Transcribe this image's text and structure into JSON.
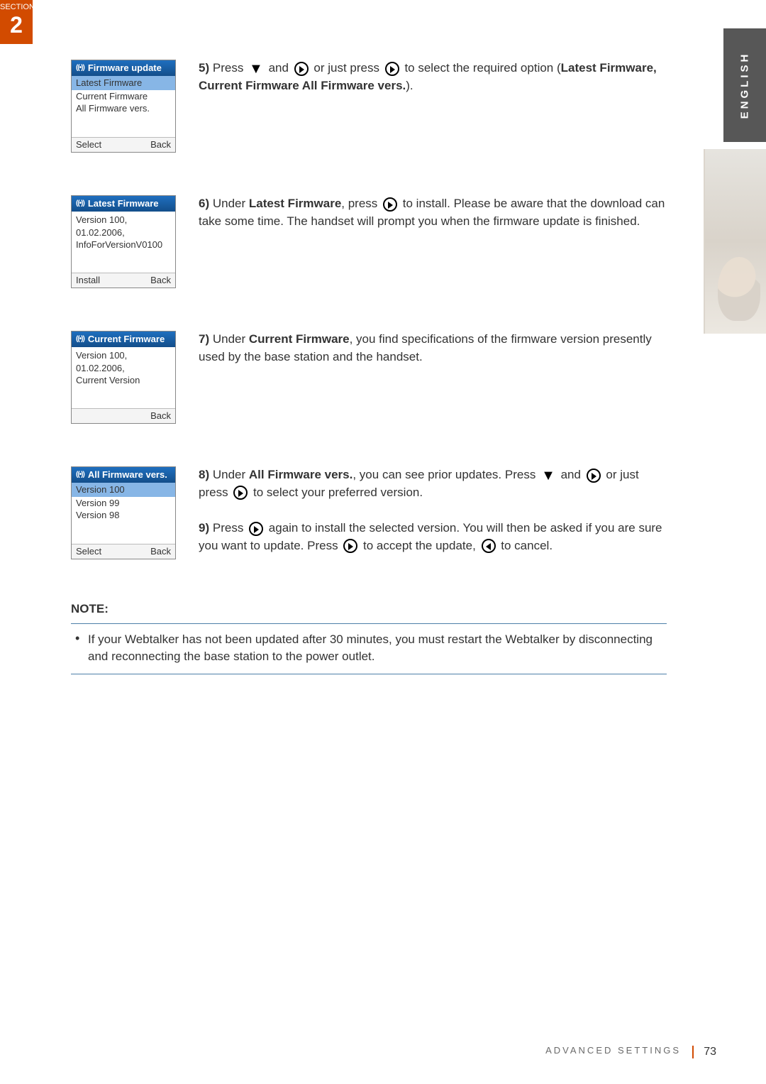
{
  "section": {
    "label": "SECTION",
    "number": "2"
  },
  "lang_tab": "ENGLISH",
  "screens": {
    "s5": {
      "title": "Firmware update",
      "items": [
        "Latest Firmware",
        "Current Firmware",
        "All Firmware vers."
      ],
      "left_soft": "Select",
      "right_soft": "Back"
    },
    "s6": {
      "title": "Latest Firmware",
      "lines": [
        "Version 100,",
        "01.02.2006,",
        "InfoForVersionV0100"
      ],
      "left_soft": "Install",
      "right_soft": "Back"
    },
    "s7": {
      "title": "Current Firmware",
      "lines": [
        "Version 100,",
        "01.02.2006,",
        "Current Version"
      ],
      "left_soft": "",
      "right_soft": "Back"
    },
    "s8": {
      "title": "All Firmware vers.",
      "items": [
        "Version 100",
        "Version 99",
        "Version 98"
      ],
      "left_soft": "Select",
      "right_soft": "Back"
    }
  },
  "steps": {
    "n5": "5)",
    "t5a": "Press ",
    "t5b": " and ",
    "t5c": " or just press ",
    "t5d": " to select the required option (",
    "t5e": "Latest Firmware, Current Firmware All Firmware vers.",
    "t5f": ").",
    "n6": "6)",
    "t6a": "Under ",
    "t6b": "Latest Firmware",
    "t6c": ", press ",
    "t6d": " to install. Please be aware that the download can take some time. The handset will prompt you when the firmware update is finished.",
    "n7": "7)",
    "t7a": "Under ",
    "t7b": "Current Firmware",
    "t7c": ", you find specifications of the firmware version presently used by the base station and the handset.",
    "n8": "8)",
    "t8a": "Under ",
    "t8b": "All Firmware vers.",
    "t8c": ", you can see prior updates. Press ",
    "t8d": " and ",
    "t8e": " or just press ",
    "t8f": " to select your preferred version.",
    "n9": "9)",
    "t9a": "Press ",
    "t9b": " again to install the selected version. You will then be asked if you are sure you want to update. Press ",
    "t9c": " to accept the update, ",
    "t9d": " to cancel."
  },
  "note": {
    "title": "NOTE:",
    "text": "If your Webtalker has not been updated after 30 minutes, you must restart the Webtalker by disconnecting and reconnecting the base station to the power outlet."
  },
  "footer": {
    "section_name": "ADVANCED SETTINGS",
    "page_number": "73"
  }
}
